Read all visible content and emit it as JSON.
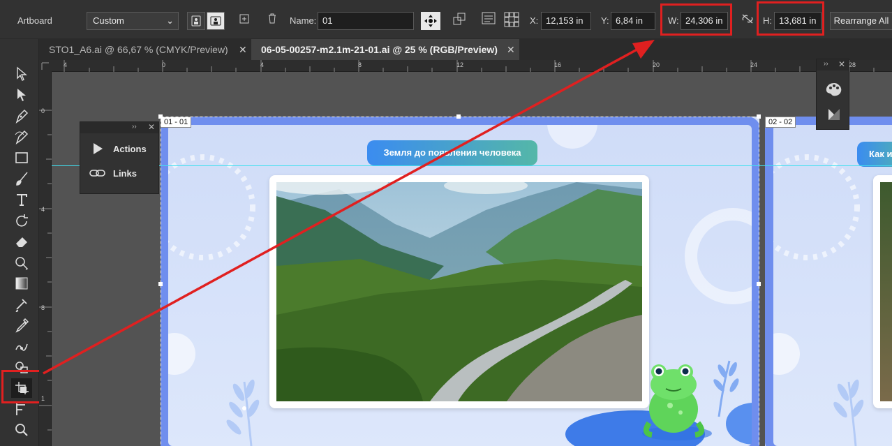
{
  "control_bar": {
    "mode_label": "Artboard",
    "preset_value": "Custom",
    "name_label": "Name:",
    "name_value": "01",
    "x_label": "X:",
    "x_value": "12,153 in",
    "y_label": "Y:",
    "y_value": "6,84 in",
    "w_label": "W:",
    "w_value": "24,306 in",
    "h_label": "H:",
    "h_value": "13,681 in",
    "rearrange_label": "Rearrange All"
  },
  "tabs": [
    {
      "label": "STO1_A6.ai @ 66,67 % (CMYK/Preview)",
      "close": "✕",
      "active": false
    },
    {
      "label": "06-05-00257-m2.1m-21-01.ai @ 25 % (RGB/Preview)",
      "close": "✕",
      "active": true
    }
  ],
  "ruler_top": [
    "4",
    "0",
    "4",
    "8",
    "12",
    "16",
    "20",
    "24",
    "28"
  ],
  "ruler_left": [
    "0",
    "4",
    "8",
    "1"
  ],
  "actions_panel": {
    "items": [
      {
        "label": "Actions",
        "icon": "play-icon"
      },
      {
        "label": "Links",
        "icon": "link-icon"
      }
    ]
  },
  "artboards": [
    {
      "label": "01 - 01",
      "title": "Земля до появления человека"
    },
    {
      "label": "02 - 02",
      "title": "Как и"
    }
  ],
  "tools": [
    "selection-tool-icon",
    "direct-selection-tool-icon",
    "pen-tool-icon",
    "curvature-tool-icon",
    "rectangle-tool-icon",
    "paintbrush-tool-icon",
    "type-tool-icon",
    "rotate-tool-icon",
    "eraser-tool-icon",
    "shape-builder-tool-icon",
    "gradient-tool-icon",
    "eyedropper-chain-tool-icon",
    "eyedropper-tool-icon",
    "puppet-warp-tool-icon",
    "perspective-tool-icon",
    "artboard-tool-icon",
    "column-graph-tool-icon",
    "zoom-tool-icon"
  ],
  "colors": {
    "highlight": "#e02020",
    "frame": "#6f8eee",
    "guide": "#40e0f0"
  }
}
